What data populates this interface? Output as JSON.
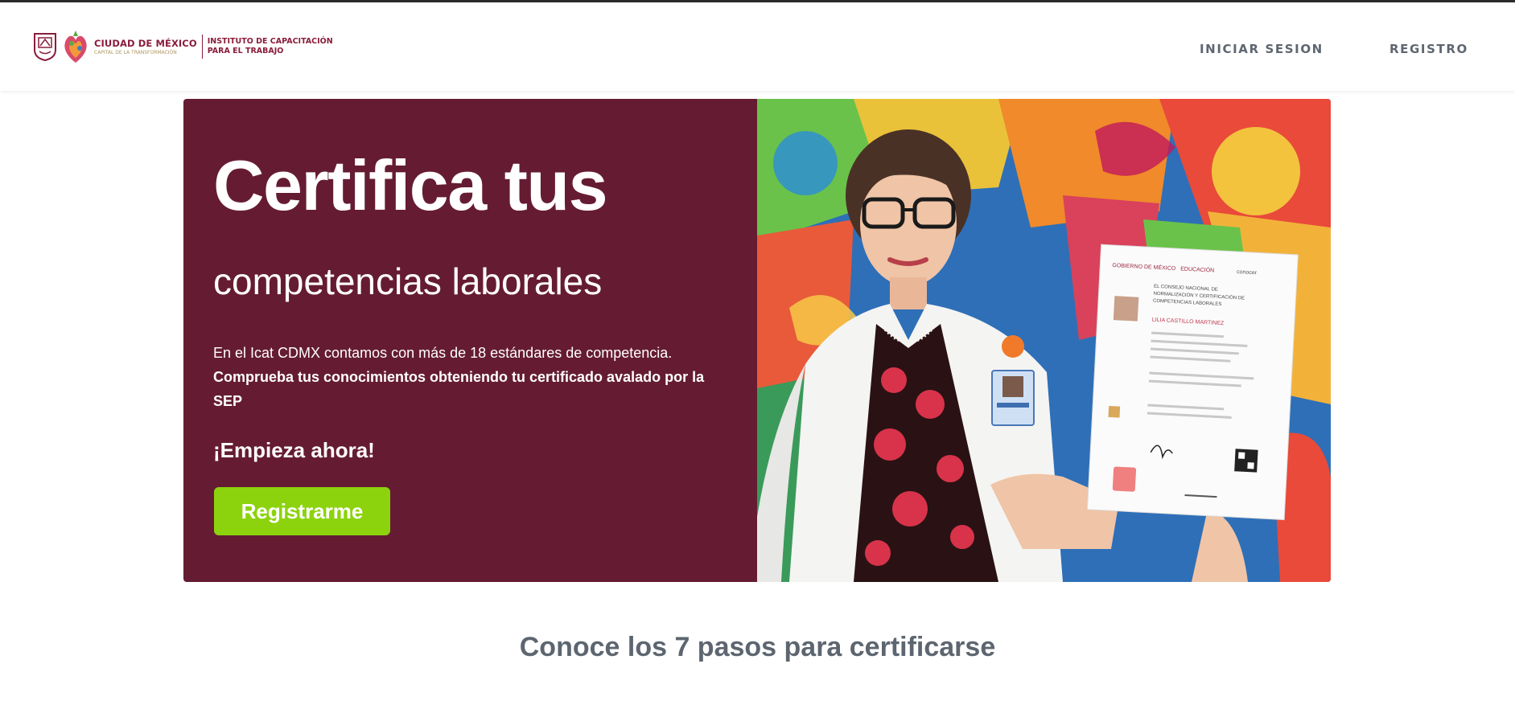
{
  "logo": {
    "city_name": "CIUDAD DE MÉXICO",
    "city_tagline": "CAPITAL DE LA TRANSFORMACIÓN",
    "institute_line1": "INSTITUTO DE CAPACITACIÓN",
    "institute_line2": "PARA EL TRABAJO"
  },
  "nav": {
    "login": "INICIAR SESION",
    "register": "REGISTRO"
  },
  "hero": {
    "title": "Certifica tus",
    "subtitle": "competencias laborales",
    "text_normal": "En el Icat CDMX contamos con más de 18 estándares de competencia.",
    "text_bold": "Comprueba tus conocimientos obteniendo tu certificado avalado por la SEP",
    "cta_text": "¡Empieza ahora!",
    "button_label": "Registrarme"
  },
  "certificate": {
    "org": "GOBIERNO DE MÉXICO",
    "education": "EDUCACIÓN",
    "brand": "conocer",
    "council_line1": "EL CONSEJO NACIONAL DE",
    "council_line2": "NORMALIZACIÓN Y CERTIFICACIÓN DE",
    "council_line3": "COMPETENCIAS LABORALES",
    "holder_name": "LILIA CASTILLO MARTINEZ"
  },
  "section": {
    "title": "Conoce los 7 pasos para certificarse"
  },
  "colors": {
    "hero_bg": "#651c32",
    "button_bg": "#8cd30e",
    "nav_text": "#5d6670",
    "brand": "#8a1d3c"
  }
}
